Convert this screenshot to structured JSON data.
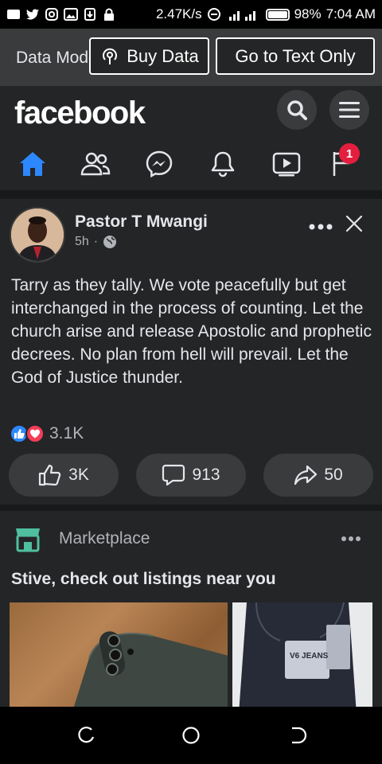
{
  "status_bar": {
    "speed": "2.47K/s",
    "battery": "98%",
    "time": "7:04 AM"
  },
  "data_mode": {
    "label": "Data Mode",
    "buy_data": "Buy Data",
    "text_only": "Go to Text Only"
  },
  "header": {
    "logo": "facebook",
    "nav_badge": "1"
  },
  "post": {
    "author": "Pastor T Mwangi",
    "time": "5h",
    "separator": "·",
    "text": "Tarry as they tally.  We vote peacefully but get interchanged in the process of counting. Let the church arise and release Apostolic and prophetic decrees. No plan from hell will prevail. Let the God of Justice thunder.",
    "reaction_count": "3.1K",
    "likes": "3K",
    "comments": "913",
    "shares": "50"
  },
  "marketplace": {
    "title": "Marketplace",
    "heading": "Stive, check out listings near you",
    "listing_brand": "V6 JEANS"
  },
  "colors": {
    "accent": "#2d88ff",
    "badge": "#e41e3f",
    "love": "#f33e58",
    "surface": "#242526",
    "background": "#18191a"
  }
}
